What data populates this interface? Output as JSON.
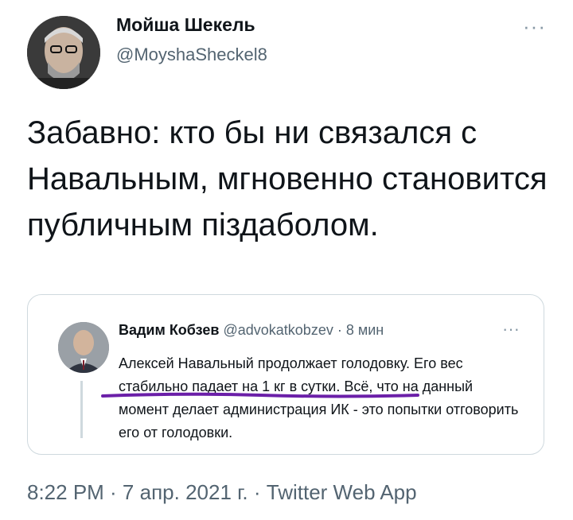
{
  "tweet": {
    "author_name": "Мойша Шекель",
    "author_handle": "@MoyshaSheckel8",
    "text": "Забавно: кто бы ни связался с Навальным, мгновенно становится публичным піздаболом.",
    "more_icon": "more-dots-icon",
    "footer": "8:22 PM · 7 апр. 2021 г. · Twitter Web App"
  },
  "quoted": {
    "author_name": "Вадим Кобзев",
    "author_handle": "@advokatkobzev",
    "time": "· 8 мин",
    "text": "Алексей Навальный продолжает голодовку. Его вес стабильно падает на 1 кг в сутки. Всё, что на данный момент делает администрация ИК - это попытки отговорить его от голодовки.",
    "more_icon": "more-dots-icon",
    "underline_color": "#6b1fa8"
  }
}
